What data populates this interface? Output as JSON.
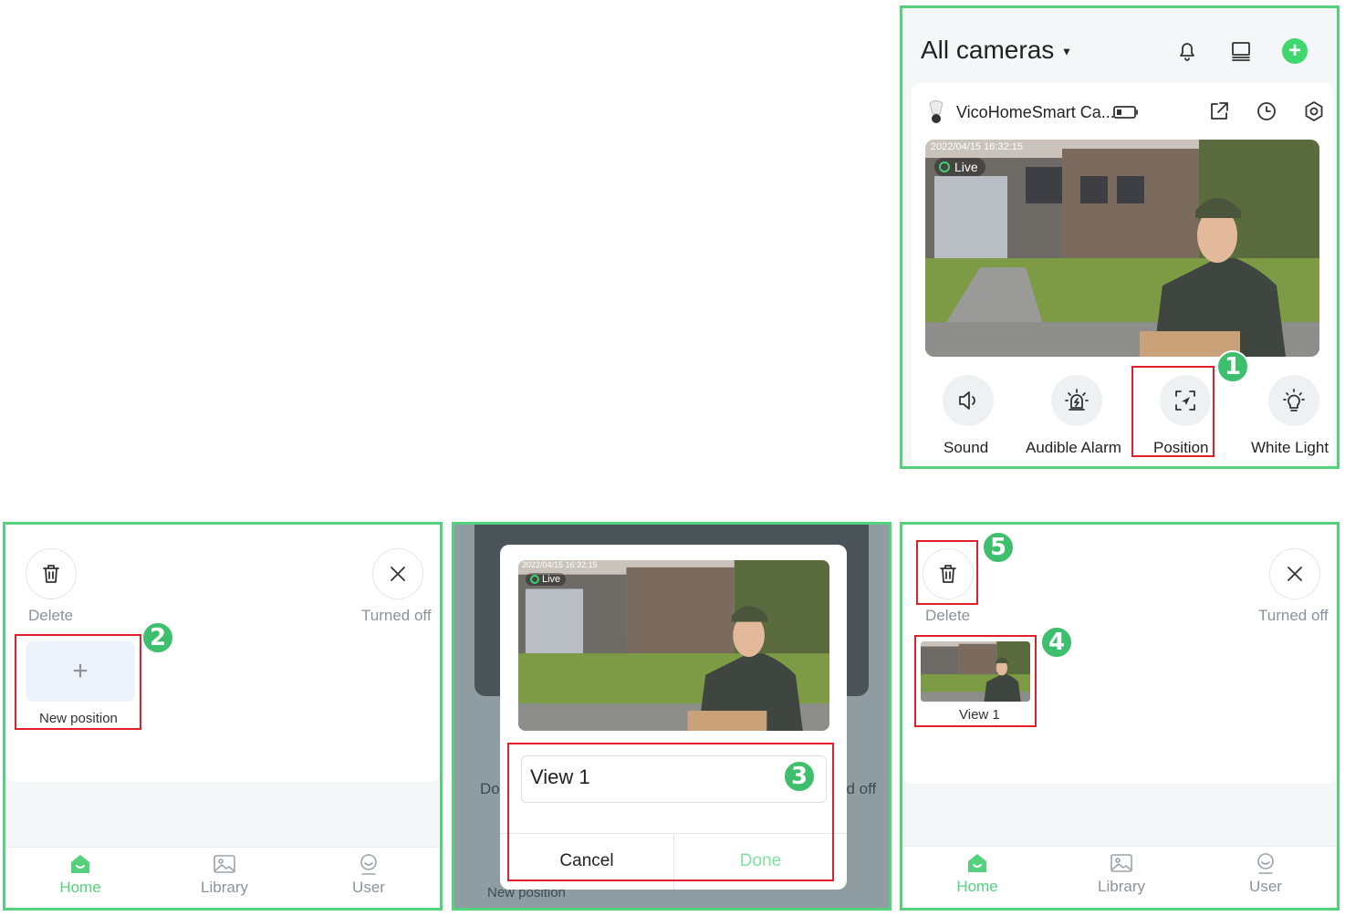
{
  "colors": {
    "accent": "#55d17e",
    "highlight": "#e0202a",
    "marker": "#3dbf6e"
  },
  "panel1": {
    "title": "All cameras",
    "device_name": "VicoHomeSmart Ca...",
    "timestamp": "2022/04/15  16:32:15",
    "live_label": "Live",
    "features": [
      {
        "label": "Sound",
        "icon": "speaker-icon"
      },
      {
        "label": "Audible Alarm",
        "icon": "alarm-icon"
      },
      {
        "label": "Position",
        "icon": "position-icon"
      },
      {
        "label": "White Light",
        "icon": "lightbulb-icon"
      }
    ]
  },
  "panel2": {
    "delete_label": "Delete",
    "turned_off_label": "Turned off",
    "new_position_label": "New position",
    "plus": "+"
  },
  "panel3": {
    "timestamp": "2022/04/15  16:32:15",
    "live_label": "Live",
    "input_value": "View 1",
    "cancel_label": "Cancel",
    "done_label": "Done",
    "bg_left_label": "Do",
    "bg_right_label": "ed off",
    "bg_bottom_label": "New position"
  },
  "panel4": {
    "delete_label": "Delete",
    "turned_off_label": "Turned off",
    "view_label": "View 1"
  },
  "tabbar": {
    "home": "Home",
    "library": "Library",
    "user": "User"
  },
  "markers": [
    "1",
    "2",
    "3",
    "4",
    "5"
  ]
}
